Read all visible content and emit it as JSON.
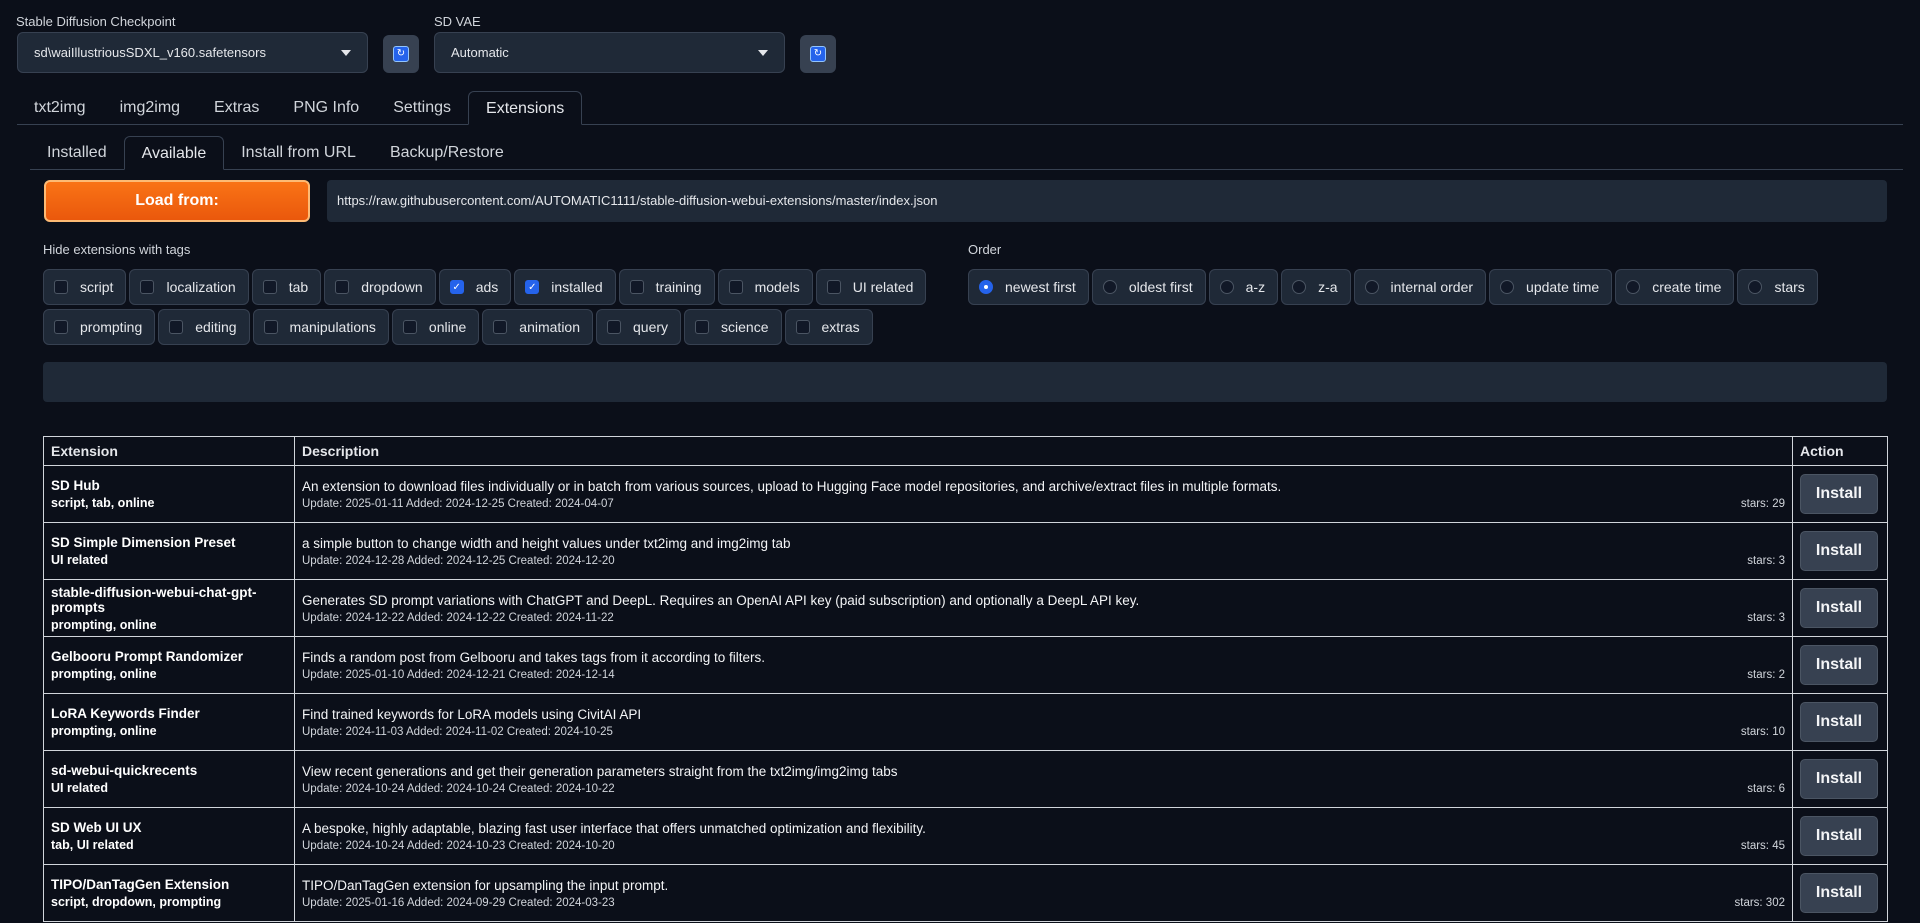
{
  "top": {
    "checkpoint": {
      "label": "Stable Diffusion Checkpoint",
      "value": "sd\\waiIllustriousSDXL_v160.safetensors"
    },
    "vae": {
      "label": "SD VAE",
      "value": "Automatic"
    }
  },
  "main_tabs": [
    "txt2img",
    "img2img",
    "Extras",
    "PNG Info",
    "Settings",
    "Extensions"
  ],
  "main_tab_active": "Extensions",
  "sub_tabs": [
    "Installed",
    "Available",
    "Install from URL",
    "Backup/Restore"
  ],
  "sub_tab_active": "Available",
  "load": {
    "button_label": "Load from:",
    "url": "https://raw.githubusercontent.com/AUTOMATIC1111/stable-diffusion-webui-extensions/master/index.json"
  },
  "hide_tags": {
    "label": "Hide extensions with tags",
    "row1": [
      {
        "label": "script",
        "checked": false
      },
      {
        "label": "localization",
        "checked": false
      },
      {
        "label": "tab",
        "checked": false
      },
      {
        "label": "dropdown",
        "checked": false
      },
      {
        "label": "ads",
        "checked": true
      },
      {
        "label": "installed",
        "checked": true
      },
      {
        "label": "training",
        "checked": false
      },
      {
        "label": "models",
        "checked": false
      },
      {
        "label": "UI related",
        "checked": false
      }
    ],
    "row2": [
      {
        "label": "prompting",
        "checked": false
      },
      {
        "label": "editing",
        "checked": false
      },
      {
        "label": "manipulations",
        "checked": false
      },
      {
        "label": "online",
        "checked": false
      },
      {
        "label": "animation",
        "checked": false
      },
      {
        "label": "query",
        "checked": false
      },
      {
        "label": "science",
        "checked": false
      },
      {
        "label": "extras",
        "checked": false
      }
    ]
  },
  "order": {
    "label": "Order",
    "options": [
      {
        "label": "newest first",
        "selected": true
      },
      {
        "label": "oldest first",
        "selected": false
      },
      {
        "label": "a-z",
        "selected": false
      },
      {
        "label": "z-a",
        "selected": false
      },
      {
        "label": "internal order",
        "selected": false
      },
      {
        "label": "update time",
        "selected": false
      },
      {
        "label": "create time",
        "selected": false
      },
      {
        "label": "stars",
        "selected": false
      }
    ]
  },
  "table": {
    "headers": [
      "Extension",
      "Description",
      "Action"
    ],
    "action_label": "Install",
    "rows": [
      {
        "name": "SD Hub",
        "tags": "script, tab, online",
        "desc": "An extension to download files individually or in batch from various sources, upload to Hugging Face model repositories, and archive/extract files in multiple formats.",
        "meta": "Update: 2025-01-11 Added: 2024-12-25 Created: 2024-04-07",
        "stars": "stars: 29"
      },
      {
        "name": "SD Simple Dimension Preset",
        "tags": "UI related",
        "desc": "a simple button to change width and height values under txt2img and img2img tab",
        "meta": "Update: 2024-12-28 Added: 2024-12-25 Created: 2024-12-20",
        "stars": "stars: 3"
      },
      {
        "name": "stable-diffusion-webui-chat-gpt-prompts",
        "tags": "prompting, online",
        "desc": "Generates SD prompt variations with ChatGPT and DeepL. Requires an OpenAI API key (paid subscription) and optionally a DeepL API key.",
        "meta": "Update: 2024-12-22 Added: 2024-12-22 Created: 2024-11-22",
        "stars": "stars: 3"
      },
      {
        "name": "Gelbooru Prompt Randomizer",
        "tags": "prompting, online",
        "desc": "Finds a random post from Gelbooru and takes tags from it according to filters.",
        "meta": "Update: 2025-01-10 Added: 2024-12-21 Created: 2024-12-14",
        "stars": "stars: 2"
      },
      {
        "name": "LoRA Keywords Finder",
        "tags": "prompting, online",
        "desc": "Find trained keywords for LoRA models using CivitAI API",
        "meta": "Update: 2024-11-03 Added: 2024-11-02 Created: 2024-10-25",
        "stars": "stars: 10"
      },
      {
        "name": "sd-webui-quickrecents",
        "tags": "UI related",
        "desc": "View recent generations and get their generation parameters straight from the txt2img/img2img tabs",
        "meta": "Update: 2024-10-24 Added: 2024-10-24 Created: 2024-10-22",
        "stars": "stars: 6"
      },
      {
        "name": "SD Web UI UX",
        "tags": "tab, UI related",
        "desc": "A bespoke, highly adaptable, blazing fast user interface that offers unmatched optimization and flexibility.",
        "meta": "Update: 2024-10-24 Added: 2024-10-23 Created: 2024-10-20",
        "stars": "stars: 45"
      },
      {
        "name": "TIPO/DanTagGen Extension",
        "tags": "script, dropdown, prompting",
        "desc": "TIPO/DanTagGen extension for upsampling the input prompt.",
        "meta": "Update: 2025-01-16 Added: 2024-09-29 Created: 2024-03-23",
        "stars": "stars: 302"
      }
    ]
  }
}
